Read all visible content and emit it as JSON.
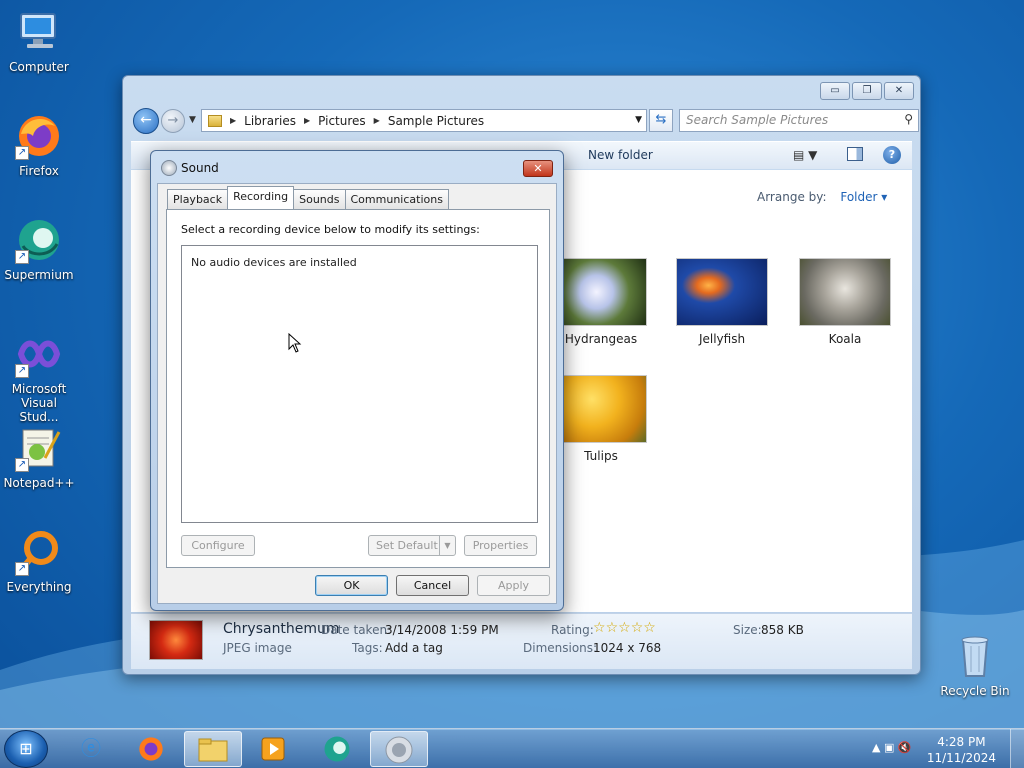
{
  "desktop": {
    "icons": [
      {
        "label": "Computer",
        "icon": "computer-icon"
      },
      {
        "label": "Firefox",
        "icon": "firefox-icon"
      },
      {
        "label": "Supermium",
        "icon": "supermium-icon"
      },
      {
        "label": "Microsoft Visual Stud...",
        "icon": "visual-studio-icon"
      },
      {
        "label": "Notepad++",
        "icon": "notepadpp-icon"
      },
      {
        "label": "Everything",
        "icon": "everything-icon"
      },
      {
        "label": "Recycle Bin",
        "icon": "recycle-bin-icon"
      }
    ]
  },
  "explorer": {
    "breadcrumb": [
      "Libraries",
      "Pictures",
      "Sample Pictures"
    ],
    "search_placeholder": "Search Sample Pictures",
    "toolbar": {
      "new_folder": "New folder"
    },
    "arrange_label": "Arrange by:",
    "arrange_value": "Folder",
    "thumbnails": [
      {
        "label": "Hydrangeas",
        "color": "#8a9d6a"
      },
      {
        "label": "Jellyfish",
        "color": "#1d3d8f"
      },
      {
        "label": "Koala",
        "color": "#8f8a82"
      },
      {
        "label": "Tulips",
        "color": "#e5a516"
      }
    ],
    "details": {
      "name": "Chrysanthemum",
      "type": "JPEG image",
      "date_taken_label": "Date taken:",
      "date_taken": "3/14/2008 1:59 PM",
      "tags_label": "Tags:",
      "tags": "Add a tag",
      "rating_label": "Rating:",
      "rating": 0,
      "dimensions_label": "Dimensions:",
      "dimensions": "1024 x 768",
      "size_label": "Size:",
      "size": "858 KB"
    }
  },
  "dialog": {
    "title": "Sound",
    "close": "✕",
    "tabs": [
      "Playback",
      "Recording",
      "Sounds",
      "Communications"
    ],
    "active_tab": "Recording",
    "hint": "Select a recording device below to modify its settings:",
    "empty_message": "No audio devices are installed",
    "buttons": {
      "configure": "Configure",
      "set_default": "Set Default",
      "properties": "Properties",
      "ok": "OK",
      "cancel": "Cancel",
      "apply": "Apply"
    }
  },
  "taskbar": {
    "time": "4:28 PM",
    "date": "11/11/2024"
  }
}
